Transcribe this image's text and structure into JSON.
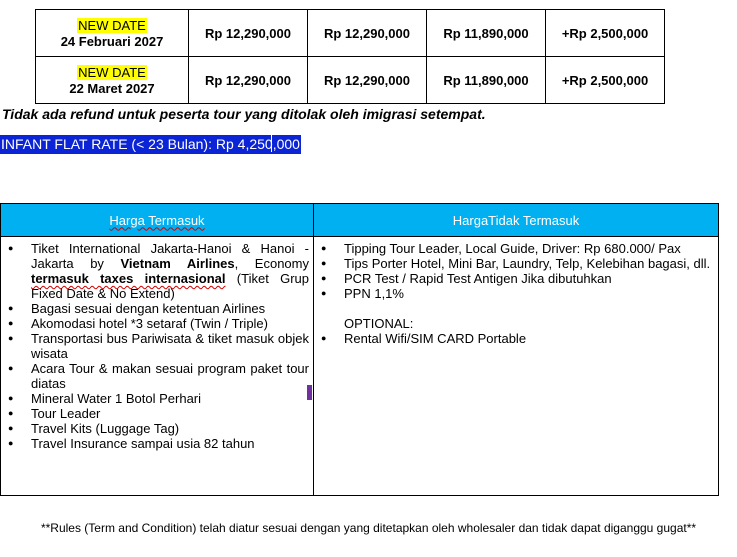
{
  "price_rows": [
    {
      "badge": "NEW DATE",
      "date": "24 Februari 2027",
      "cells": [
        "Rp 12,290,000",
        "Rp 12,290,000",
        "Rp 11,890,000",
        "+Rp 2,500,000"
      ]
    },
    {
      "badge": "NEW DATE",
      "date": "22 Maret 2027",
      "cells": [
        "Rp 12,290,000",
        "Rp 12,290,000",
        "Rp 11,890,000",
        "+Rp 2,500,000"
      ]
    }
  ],
  "note": "Tidak ada refund untuk peserta tour yang ditolak oleh imigrasi setempat.",
  "infant": "INFANT FLAT RATE (< 23 Bulan): Rp 4,250,000",
  "included_header": "Harga Termasuk",
  "excluded_header": "HargaTidak Termasuk",
  "included": {
    "item0_a": "Tiket International Jakarta-Hanoi & Hanoi - Jakarta by ",
    "item0_b": "Vietnam Airlines",
    "item0_c": ", Economy ",
    "item0_d": "termasuk taxes internasional",
    "item0_e": " (Tiket Grup Fixed Date & No Extend)",
    "items": [
      "Bagasi sesuai dengan ketentuan Airlines",
      "Akomodasi hotel *3 setaraf (Twin / Triple)",
      "Transportasi bus Pariwisata & tiket masuk objek wisata",
      "Acara Tour & makan sesuai program paket tour diatas",
      "Mineral Water 1 Botol Perhari",
      "Tour Leader",
      "Travel Kits (Luggage Tag)",
      "Travel Insurance sampai usia 82 tahun"
    ]
  },
  "excluded": {
    "items": [
      "Tipping Tour Leader, Local Guide, Driver: Rp 680.000/ Pax",
      "Tips Porter Hotel, Mini Bar, Laundry, Telp, Kelebihan bagasi, dll.",
      "PCR Test / Rapid Test Antigen Jika dibutuhkan",
      "PPN 1,1%"
    ],
    "optional_label": "OPTIONAL:",
    "optional_item": "Rental Wifi/SIM CARD Portable"
  },
  "footer": "**Rules (Term and Condition) telah diatur sesuai dengan yang ditetapkan oleh wholesaler dan tidak dapat diganggu gugat**"
}
